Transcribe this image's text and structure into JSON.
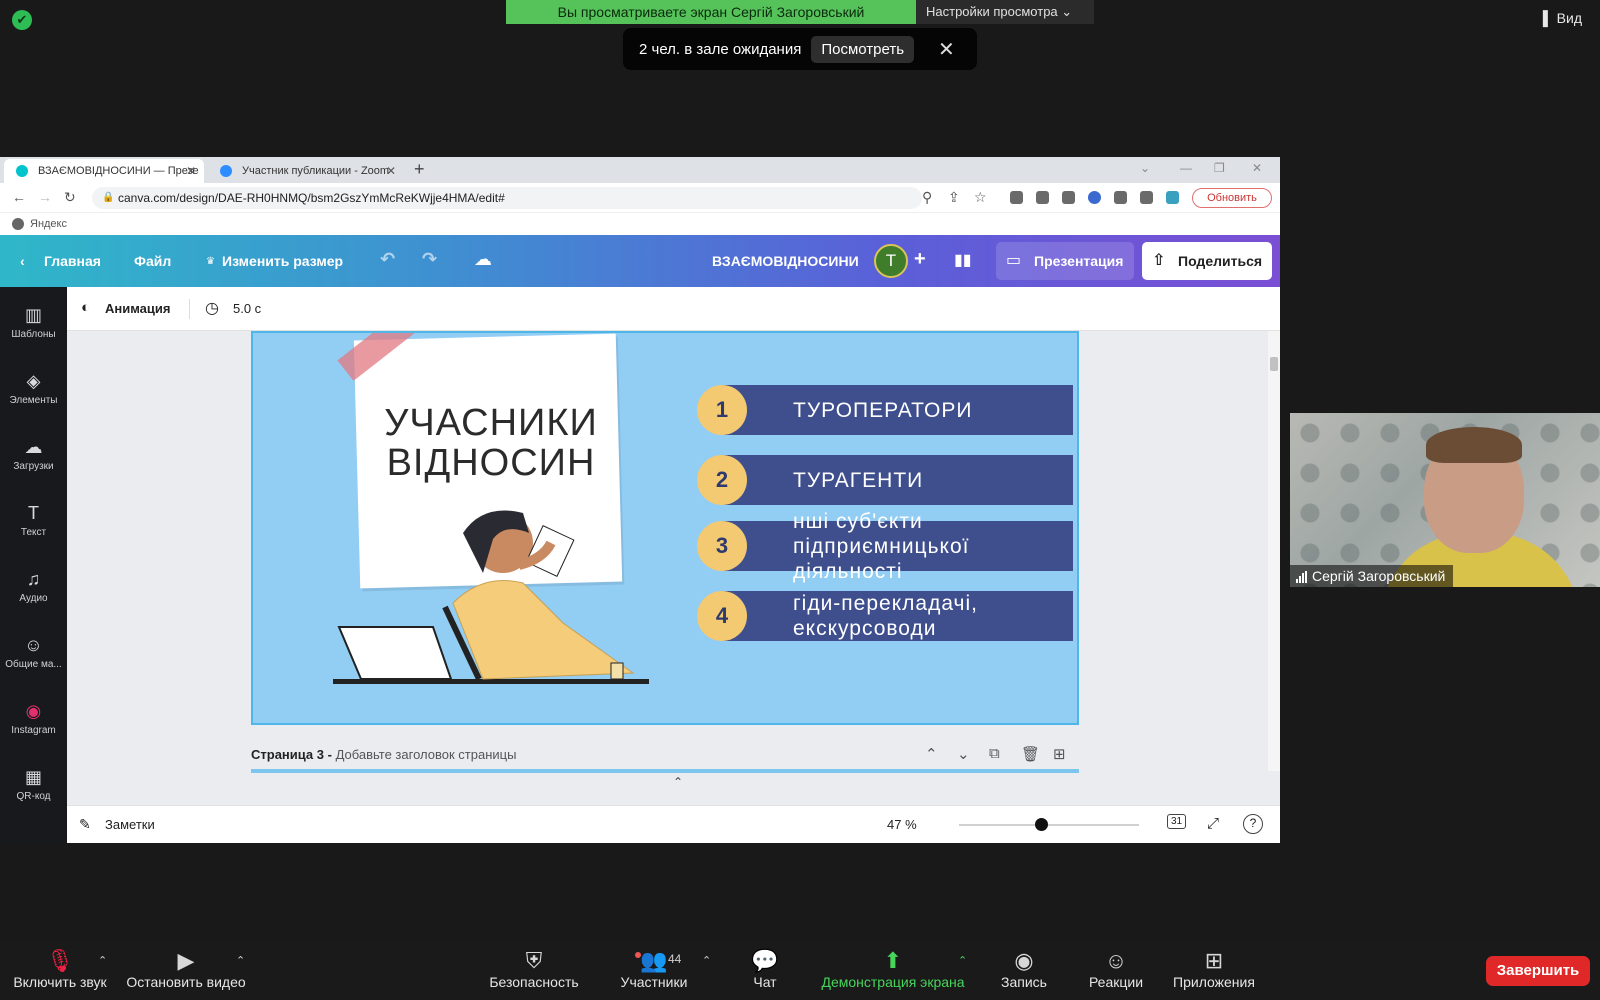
{
  "zoom": {
    "view_banner": "Вы просматриваете экран Сергій Загоровський",
    "view_settings": "Настройки просмотра",
    "view_label": "Вид",
    "waiting_text": "2 чел. в зале ожидания",
    "waiting_button": "Посмотреть",
    "participant_name": "Сергій Загоровський",
    "toolbar": {
      "mute": "Включить звук",
      "video": "Остановить видео",
      "security": "Безопасность",
      "participants": "Участники",
      "participants_count": "44",
      "chat": "Чат",
      "share": "Демонстрация экрана",
      "record": "Запись",
      "reactions": "Реакции",
      "apps": "Приложения",
      "end": "Завершить"
    }
  },
  "browser": {
    "tabs": [
      {
        "label": "ВЗАЄМОВІДНОСИНИ — Презе"
      },
      {
        "label": "Участник публикации - Zoom"
      }
    ],
    "url": "canva.com/design/DAE-RH0HNMQ/bsm2GszYmMcReKWjje4HMA/edit#",
    "update_button": "Обновить",
    "bookmark": "Яндекс"
  },
  "canva": {
    "header": {
      "home": "Главная",
      "file": "Файл",
      "resize": "Изменить размер",
      "doc_title": "ВЗАЄМОВІДНОСИНИ",
      "avatar_letter": "T",
      "present": "Презентация",
      "share": "Поделиться"
    },
    "sidebar": [
      {
        "label": "Шаблоны",
        "glyph": "▥"
      },
      {
        "label": "Элементы",
        "glyph": "◈"
      },
      {
        "label": "Загрузки",
        "glyph": "☁"
      },
      {
        "label": "Текст",
        "glyph": "T"
      },
      {
        "label": "Аудио",
        "glyph": "♫"
      },
      {
        "label": "Общие ма...",
        "glyph": "☺"
      },
      {
        "label": "Instagram",
        "glyph": "◉"
      },
      {
        "label": "QR-код",
        "glyph": "▦"
      }
    ],
    "anim_bar": {
      "animation": "Анимация",
      "duration": "5.0 с"
    },
    "slide": {
      "title_line1": "УЧАСНИКИ",
      "title_line2": "ВІДНОСИН",
      "items": [
        {
          "num": "1",
          "text": "ТУРОПЕРАТОРИ"
        },
        {
          "num": "2",
          "text": "ТУРАГЕНТИ"
        },
        {
          "num": "3",
          "text_line1": "нші суб'єкти",
          "text_line2": "підприємницької діяльності"
        },
        {
          "num": "4",
          "text_line1": "гіди-перекладачі,",
          "text_line2": "екскурсоводи"
        }
      ]
    },
    "page_label": {
      "page": "Страница 3 -",
      "placeholder": "Добавьте заголовок страницы"
    },
    "bottom": {
      "notes": "Заметки",
      "zoom": "47 %",
      "pages_count": "31"
    }
  }
}
